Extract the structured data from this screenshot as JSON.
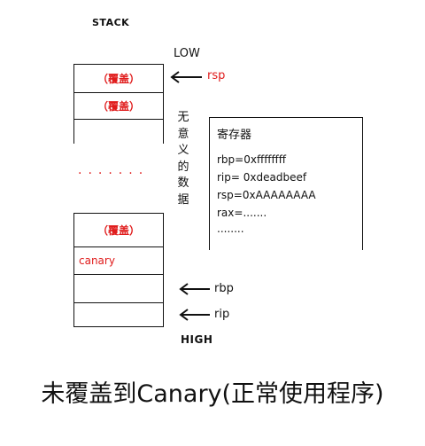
{
  "diagram": {
    "title": "STACK",
    "low_label": "LOW",
    "high_label": "HIGH",
    "cells": [
      {
        "text": "（覆盖）"
      },
      {
        "text": "（覆盖）"
      },
      {
        "text": "（覆盖）"
      },
      {
        "text": "canary"
      },
      {
        "text": ""
      },
      {
        "text": ""
      }
    ],
    "ellipsis": "·······",
    "vertical_note": [
      "无",
      "意",
      "义",
      "的",
      "数",
      "据"
    ],
    "pointers": {
      "rsp": "rsp",
      "rbp": "rbp",
      "rip": "rip"
    },
    "registers": {
      "title": "寄存器",
      "lines": [
        "rbp=0xffffffff",
        "rip= 0xdeadbeef",
        "rsp=0xAAAAAAAA",
        "rax=.......",
        "........"
      ]
    },
    "caption": "未覆盖到Canary(正常使用程序)",
    "colors": {
      "accent": "#e01b1b",
      "line": "#111111"
    }
  }
}
